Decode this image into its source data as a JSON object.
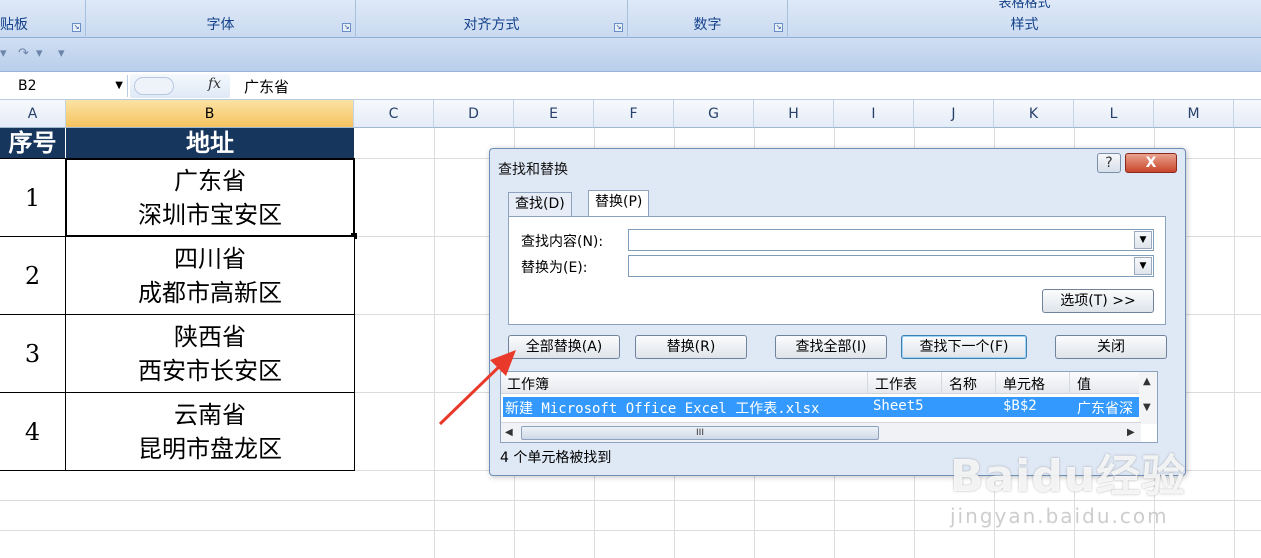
{
  "ribbon": {
    "groups": [
      "贴板",
      "字体",
      "对齐方式",
      "数字",
      "样式"
    ],
    "styles_top_partial": "表格格式"
  },
  "qat": {
    "undo": "↶",
    "redo": "↷",
    "menu": "▾"
  },
  "formula_bar": {
    "name_box": "B2",
    "fx": "fx",
    "value": "广东省"
  },
  "columns": [
    "A",
    "B",
    "C",
    "D",
    "E",
    "F",
    "G",
    "H",
    "I",
    "J",
    "K",
    "L",
    "M"
  ],
  "table": {
    "headers": [
      "序号",
      "地址"
    ],
    "rows": [
      {
        "num": "1",
        "line1": "广东省",
        "line2": "深圳市宝安区"
      },
      {
        "num": "2",
        "line1": "四川省",
        "line2": "成都市高新区"
      },
      {
        "num": "3",
        "line1": "陕西省",
        "line2": "西安市长安区"
      },
      {
        "num": "4",
        "line1": "云南省",
        "line2": "昆明市盘龙区"
      }
    ]
  },
  "dialog": {
    "title": "查找和替换",
    "help": "?",
    "close_x": "X",
    "tabs": [
      "查找(D)",
      "替换(P)"
    ],
    "find_label": "查找内容(N):",
    "replace_label": "替换为(E):",
    "find_value": "",
    "replace_value": "",
    "options_btn": "选项(T) >>",
    "buttons": [
      "全部替换(A)",
      "替换(R)",
      "查找全部(I)",
      "查找下一个(F)",
      "关闭"
    ],
    "results_headers": [
      "工作簿",
      "工作表",
      "名称",
      "单元格",
      "值"
    ],
    "result_row": {
      "workbook": "新建 Microsoft Office Excel 工作表.xlsx",
      "sheet": "Sheet5",
      "name": "",
      "cell": "$B$2",
      "value": "广东省深"
    },
    "scroll_thumb": "III",
    "status": "4 个单元格被找到"
  },
  "watermark": {
    "brand": "Baidu经验",
    "url": "jingyan.baidu.com"
  }
}
